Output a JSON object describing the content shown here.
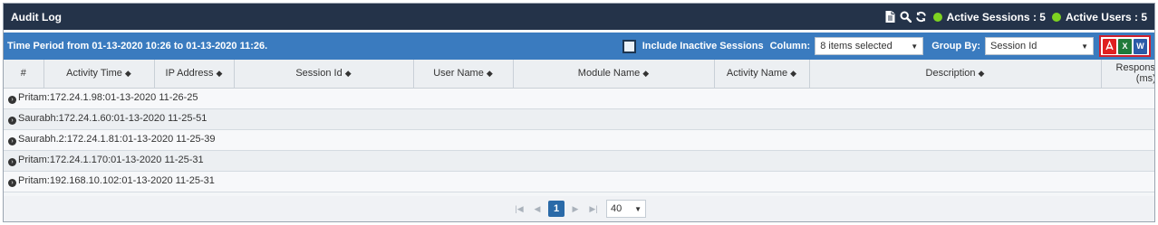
{
  "title": "Audit Log",
  "toolbar": {
    "active_sessions": "Active Sessions : 5",
    "active_users": "Active Users : 5",
    "status_color": "#7ed321"
  },
  "filter": {
    "period": "Time Period from 01-13-2020 10:26 to 01-13-2020 11:26.",
    "include_inactive_label": "Include Inactive Sessions",
    "column_label": "Column:",
    "column_value": "8 items selected",
    "group_by_label": "Group By:",
    "group_by_value": "Session Id"
  },
  "export": {
    "pdf": "PDF",
    "excel": "X",
    "word": "W"
  },
  "columns": [
    "#",
    "Activity Time",
    "IP Address",
    "Session Id",
    "User Name",
    "Module Name",
    "Activity Name",
    "Description",
    "Response Time (ms)"
  ],
  "groups": [
    "Pritam:172.24.1.98:01-13-2020 11-26-25",
    "Saurabh:172.24.1.60:01-13-2020 11-25-51",
    "Saurabh.2:172.24.1.81:01-13-2020 11-25-39",
    "Pritam:172.24.1.170:01-13-2020 11-25-31",
    "Pritam:192.168.10.102:01-13-2020 11-25-31"
  ],
  "pager": {
    "current_page": "1",
    "page_size": "40"
  }
}
